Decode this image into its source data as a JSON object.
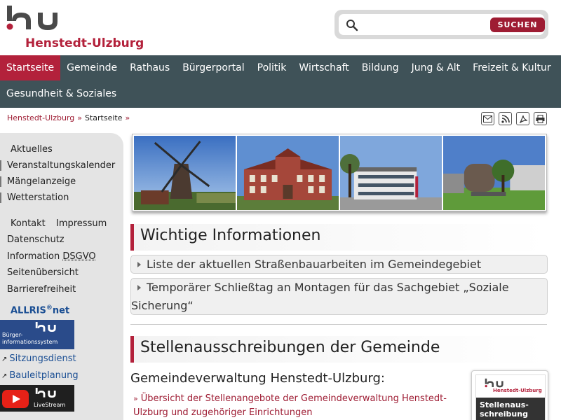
{
  "header": {
    "logo_text": "Henstedt-Ulzburg",
    "search": {
      "placeholder": "",
      "button_label": "SUCHEN"
    }
  },
  "nav": {
    "row1": [
      "Startseite",
      "Gemeinde",
      "Rathaus",
      "Bürgerportal",
      "Politik",
      "Wirtschaft",
      "Bildung",
      "Jung & Alt",
      "Freizeit & Kultur"
    ],
    "row2": [
      "Gesundheit & Soziales"
    ],
    "active": "Startseite"
  },
  "breadcrumb": {
    "home": "Henstedt-Ulzburg",
    "sep": "»",
    "current": "Startseite"
  },
  "tools": [
    "mail-icon",
    "rss-icon",
    "pdf-icon",
    "print-icon"
  ],
  "sidebar": {
    "aktuelles": "Aktuelles",
    "items": [
      "Veranstaltungskalender",
      "Mängelanzeige",
      "Wetterstation"
    ],
    "kontakt": "Kontakt",
    "impressum": "Impressum",
    "datenschutz": "Datenschutz",
    "information": "Information",
    "dsgvo": "DSGVO",
    "seitenuebersicht": "Seitenübersicht",
    "barrierefreiheit": "Barrierefreiheit",
    "allris": "ALLRIS",
    "allris_sup": "®",
    "allris_net": "net",
    "bis_line1": "Bürger-",
    "bis_line2": "informationssystem",
    "sitzungsdienst": "Sitzungsdienst",
    "bauleitplanung": "Bauleitplanung",
    "arrow": "↗",
    "livestream": "LiveStream"
  },
  "main": {
    "section1_title": "Wichtige Informationen",
    "accordion": [
      "Liste der aktuellen Straßenbauarbeiten im Gemeindegebiet",
      "Temporärer Schließtag an Montagen für das Sachgebiet „Soziale Sicherung“"
    ],
    "section2_title": "Stellenausschreibungen der Gemeinde",
    "subhead": "Gemeindeverwaltung Henstedt-Ulzburg:",
    "job_link_arrow": "»",
    "job_link": "Übersicht der Stellenangebote der Gemeindeverwaltung Henstedt-Ulzburg und zugehöriger Einrichtungen",
    "card_name": "Henstedt-Ulzburg",
    "card_title_1": "Stellenaus-",
    "card_title_2": "schreibung"
  },
  "colors": {
    "brand": "#b3213b",
    "nav_bg": "#3f5258",
    "link_blue": "#1a4e93"
  }
}
